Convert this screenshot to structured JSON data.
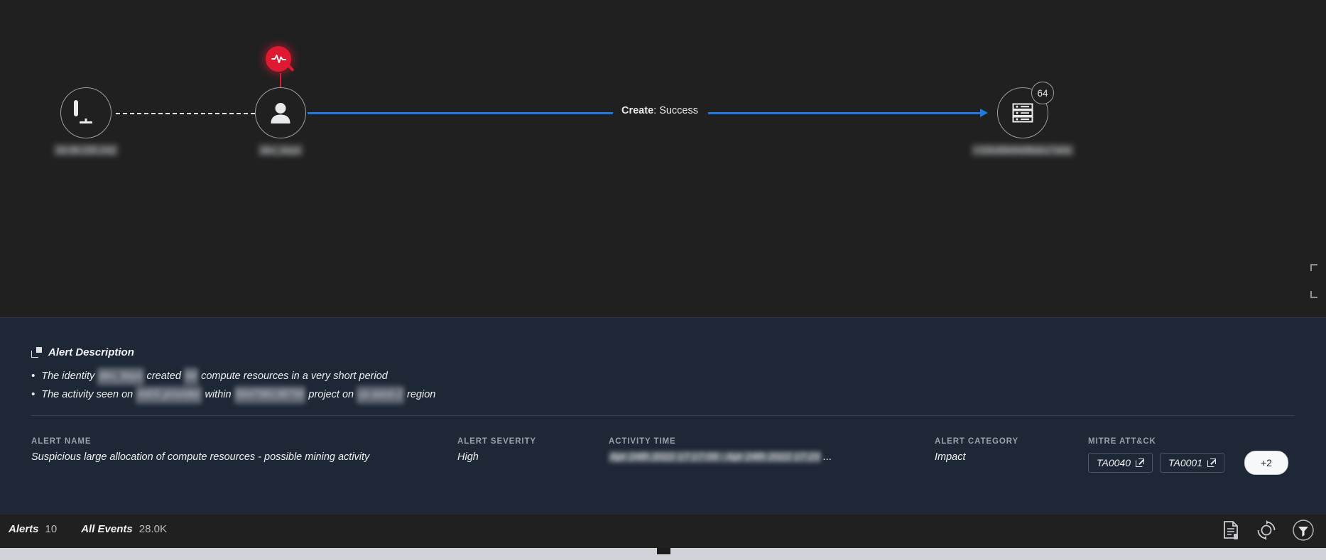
{
  "graph": {
    "nodes": [
      {
        "id": "source-host",
        "icon": "monitor-icon",
        "label": "34.99.235.242",
        "redacted": true,
        "badge": null
      },
      {
        "id": "identity",
        "icon": "user-icon",
        "label": "dev_keys",
        "redacted": true,
        "badge": null,
        "alert_badge": "investigate-alert-icon"
      },
      {
        "id": "compute-resource",
        "icon": "server-icon",
        "label": "i-02b48b94d9bdcc7a0e",
        "redacted": true,
        "badge": "64"
      }
    ],
    "edges": [
      {
        "from": "source-host",
        "to": "identity",
        "style": "dashed",
        "label": ""
      },
      {
        "from": "identity",
        "to": "compute-resource",
        "style": "solid-arrow",
        "label_bold": "Create",
        "label_rest": ": Success"
      }
    ],
    "accent_edge_color": "#1f7ae0",
    "alert_color": "#e01933"
  },
  "detail": {
    "header": "Alert Description",
    "bullets": [
      {
        "parts": [
          {
            "t": "The identity ",
            "redacted": false
          },
          {
            "t": "dev_keys",
            "redacted": true
          },
          {
            "t": " created ",
            "redacted": false
          },
          {
            "t": "64",
            "redacted": true
          },
          {
            "t": " compute resources in a very short period",
            "redacted": false
          }
        ]
      },
      {
        "parts": [
          {
            "t": "The activity seen on ",
            "redacted": false
          },
          {
            "t": "AWS provider",
            "redacted": true
          },
          {
            "t": " within ",
            "redacted": false
          },
          {
            "t": "664798138756",
            "redacted": true
          },
          {
            "t": " project on ",
            "redacted": false
          },
          {
            "t": "us-west-2",
            "redacted": true
          },
          {
            "t": " region",
            "redacted": false
          }
        ]
      }
    ],
    "bullet_marker": "•",
    "meta": {
      "alert_name": {
        "label": "ALERT NAME",
        "value": "Suspicious large allocation of compute resources - possible mining activity"
      },
      "alert_severity": {
        "label": "ALERT SEVERITY",
        "value": "High"
      },
      "activity_time": {
        "label": "ACTIVITY TIME",
        "value": "Apr 24th 2022 17:17:09 - Apr 24th 2022 17:23",
        "redacted": true,
        "ellipsis": "..."
      },
      "alert_category": {
        "label": "ALERT CATEGORY",
        "value": "Impact"
      },
      "mitre": {
        "label": "MITRE ATT&CK",
        "tags": [
          {
            "id": "TA0040",
            "icon": "external-link-icon"
          },
          {
            "id": "TA0001",
            "icon": "external-link-icon"
          }
        ],
        "more": "+2"
      }
    }
  },
  "bottom_bar": {
    "stats": [
      {
        "key": "Alerts",
        "value": "10"
      },
      {
        "key": "All Events",
        "value": "28.0K"
      }
    ],
    "actions": [
      {
        "name": "report-icon"
      },
      {
        "name": "refresh-icon"
      },
      {
        "name": "filter-icon"
      }
    ]
  }
}
